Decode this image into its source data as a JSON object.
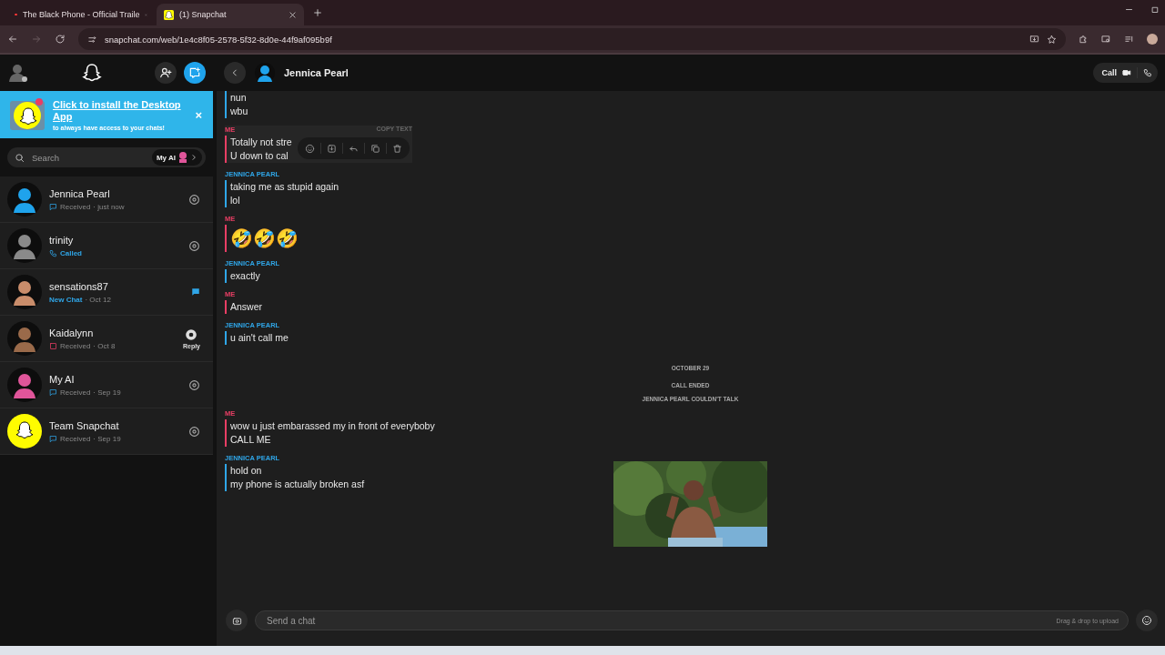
{
  "browser": {
    "tabs": [
      {
        "title": "The Black Phone - Official Traile",
        "selected": false
      },
      {
        "title": "(1) Snapchat",
        "selected": true
      }
    ],
    "url": "snapchat.com/web/1e4c8f05-2578-5f32-8d0e-44f9af095b9f"
  },
  "sidebar": {
    "banner": {
      "title": "Click to install the Desktop App",
      "subtitle": "to always have access to your chats!",
      "close": "×"
    },
    "search": {
      "placeholder": "Search",
      "chip": "My AI"
    },
    "chats": [
      {
        "name": "Jennica Pearl",
        "kind": "chat",
        "status": "Received",
        "time": "· just now",
        "avatar": {
          "kind": "person",
          "color": "#1fa3ec"
        }
      },
      {
        "name": "trinity",
        "kind": "call",
        "status": "Called",
        "avatar": {
          "kind": "person",
          "color": "#8a8a8a"
        }
      },
      {
        "name": "sensations87",
        "kind": "new",
        "status": "New Chat",
        "time": "· Oct 12",
        "avatar": {
          "kind": "person",
          "color": "#c98d6b"
        }
      },
      {
        "name": "Kaidalynn",
        "kind": "snap",
        "status": "Received",
        "time": "· Oct 8",
        "action_label": "Reply",
        "avatar": {
          "kind": "person",
          "color": "#9a6a4a"
        }
      },
      {
        "name": "My AI",
        "kind": "chat",
        "status": "Received",
        "time": "· Sep 19",
        "avatar": {
          "kind": "person",
          "color": "#e0559a"
        }
      },
      {
        "name": "Team Snapchat",
        "kind": "chat",
        "status": "Received",
        "time": "· Sep 19",
        "avatar": {
          "kind": "ghost",
          "color": "#fffc00"
        }
      }
    ]
  },
  "conversation": {
    "name": "Jennica Pearl",
    "call_label": "Call",
    "items": [
      {
        "kind": "message",
        "mine": false,
        "lines": [
          "nun",
          "wbu"
        ]
      },
      {
        "kind": "message",
        "mine": true,
        "sender": "ME",
        "hovered": true,
        "hover_label": "COPY TEXT",
        "lines": [
          "Totally not stre",
          "U down to cal"
        ]
      },
      {
        "kind": "message",
        "mine": false,
        "sender": "JENNICA PEARL",
        "lines": [
          "taking me as stupid again",
          "lol"
        ]
      },
      {
        "kind": "message",
        "mine": true,
        "sender": "ME",
        "big": true,
        "lines": [
          "🤣🤣🤣"
        ]
      },
      {
        "kind": "message",
        "mine": false,
        "sender": "JENNICA PEARL",
        "lines": [
          "exactly"
        ]
      },
      {
        "kind": "message",
        "mine": true,
        "sender": "ME",
        "lines": [
          "Answer"
        ]
      },
      {
        "kind": "message",
        "mine": false,
        "sender": "JENNICA PEARL",
        "lines": [
          "u ain't call me"
        ]
      },
      {
        "kind": "date",
        "text": "OCTOBER 29"
      },
      {
        "kind": "event",
        "text": "CALL ENDED"
      },
      {
        "kind": "event",
        "text": "JENNICA PEARL COULDN'T TALK"
      },
      {
        "kind": "message",
        "mine": true,
        "sender": "ME",
        "lines": [
          "wow u just embarassed my in front of everyboby",
          "CALL ME"
        ]
      },
      {
        "kind": "message",
        "mine": false,
        "sender": "JENNICA PEARL",
        "lines": [
          "hold on",
          "my phone is actually broken asf"
        ]
      }
    ],
    "composer": {
      "placeholder": "Send a chat",
      "hint": "Drag & drop to upload"
    }
  }
}
